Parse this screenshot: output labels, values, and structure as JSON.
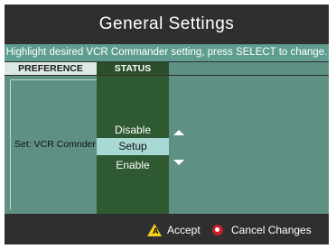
{
  "screen": {
    "title": "General Settings",
    "instruction": "Highlight desired VCR Commander setting, press SELECT to change."
  },
  "table": {
    "headers": {
      "preference": "PREFERENCE",
      "status": "STATUS"
    },
    "preference_label": "Set: VCR Comnder",
    "options": [
      "Disable",
      "Setup",
      "Enable"
    ],
    "selected_option": "Setup"
  },
  "footer": {
    "accept_label": "Accept",
    "cancel_label": "Cancel Changes"
  },
  "icons": {
    "accept": "yellow-triangle-a-icon",
    "cancel": "red-circle-icon",
    "scroll_up": "arrow-up-icon",
    "scroll_down": "arrow-down-icon"
  },
  "colors": {
    "background": "#2f2f2f",
    "instruction_bar": "#5f9d91",
    "content_teal": "#5e9184",
    "status_column": "#2f5a31",
    "selected_highlight": "#a8d8d3",
    "accept_yellow": "#f5d21b",
    "cancel_red": "#c8202a"
  }
}
